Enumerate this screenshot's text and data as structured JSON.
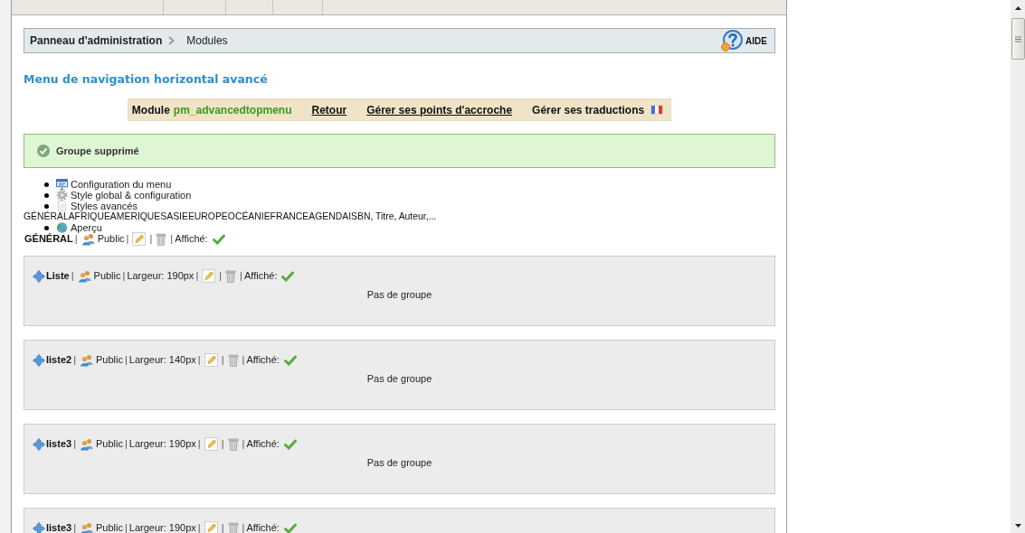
{
  "breadcrumb": {
    "items": [
      "Panneau d'administration",
      "Modules"
    ],
    "help_label": "AIDE"
  },
  "page_title": "Menu de navigation horizontal avancé",
  "module_toolbar": {
    "prefix": "Module",
    "module_name": "pm_advancedtopmenu",
    "links": [
      {
        "label": "Retour",
        "kind": "link"
      },
      {
        "label": "Gérer ses points d'accroche",
        "kind": "link"
      },
      {
        "label": "Gérer ses traductions",
        "kind": "language"
      }
    ]
  },
  "alert": {
    "success": true,
    "message": "Groupe supprimé"
  },
  "config_menu": [
    "Configuration du menu",
    "Style global & configuration",
    "Styles avancés",
    "Aperçu"
  ],
  "menu_preview": {
    "items": [
      "GÉNÉRAL",
      "AFRIQUE",
      "AMERIQUES",
      "ASIE",
      "EUROPE",
      "OCÉANIE",
      "FRANCE",
      "AGENDA"
    ],
    "search_text": "ISBN, Titre, Auteur,..."
  },
  "separator": "|",
  "tab": {
    "name": "GÉNÉRAL",
    "access": "Public",
    "displayed_label": "Affiché:",
    "displayed": true
  },
  "columns": [
    {
      "name": "Liste",
      "access": "Public",
      "width_label": "Largeur: 190px",
      "displayed_label": "Affiché:",
      "displayed": true,
      "empty_text": "Pas de groupe"
    },
    {
      "name": "liste2",
      "access": "Public",
      "width_label": "Largeur: 140px",
      "displayed_label": "Affiché:",
      "displayed": true,
      "empty_text": "Pas de groupe"
    },
    {
      "name": "liste3",
      "access": "Public",
      "width_label": "Largeur: 190px",
      "displayed_label": "Affiché:",
      "displayed": true,
      "empty_text": "Pas de groupe"
    },
    {
      "name": "liste3",
      "access": "Public",
      "width_label": "Largeur: 190px",
      "displayed_label": "Affiché:",
      "displayed": true
    }
  ]
}
